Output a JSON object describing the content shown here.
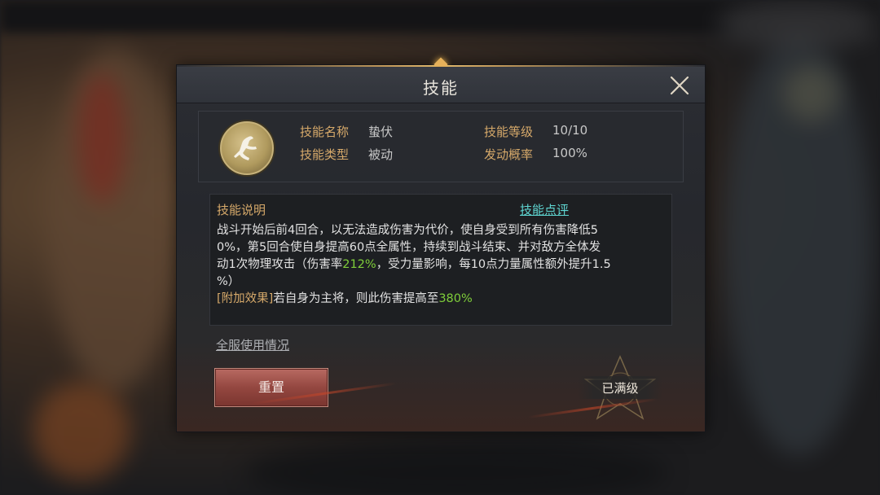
{
  "dialog": {
    "title": "技能",
    "info": {
      "name_label": "技能名称",
      "name_value": "蛰伏",
      "type_label": "技能类型",
      "type_value": "被动",
      "level_label": "技能等级",
      "level_value": "10/10",
      "chance_label": "发动概率",
      "chance_value": "100%",
      "icon": "crouching-figure-icon"
    },
    "description": {
      "title": "技能说明",
      "review_link": "技能点评",
      "line1": "战斗开始后前4回合，以无法造成伤害为代价，使自身受到所有伤害降低5",
      "line2": "0%，第5回合使自身提高60点全属性，持续到战斗结束、并对敌方全体发",
      "line3_a": "动1次物理攻击（伤害率",
      "line3_highlight": "212%",
      "line3_b": "，受力量影响，每10点力量属性额外提升1.5",
      "line4": "%）",
      "extra_tag": "[附加效果]",
      "extra_text": "若自身为主将，则此伤害提高至",
      "extra_highlight": "380%"
    },
    "usage_link": "全服使用情况",
    "reset_button": "重置",
    "max_badge": "已满级"
  },
  "colors": {
    "label_gold": "#d6a96a",
    "highlight_green": "#7fce3a",
    "link_cyan": "#5fd6d2",
    "reset_red": "#944740"
  }
}
